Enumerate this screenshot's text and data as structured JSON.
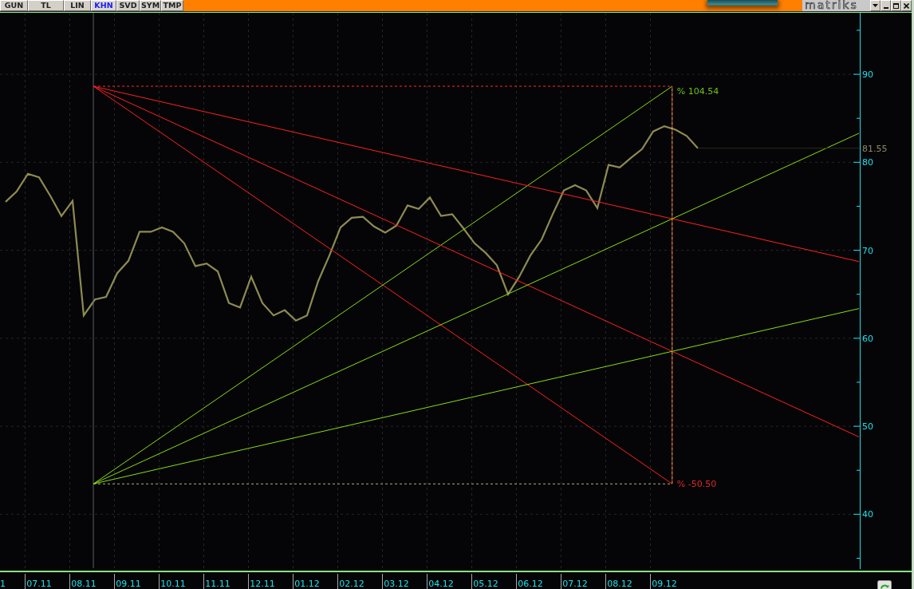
{
  "toolbar": {
    "mode_buttons": [
      {
        "label": "GUN",
        "selected": false
      },
      {
        "label": "TL",
        "selected": false
      },
      {
        "label": "LIN",
        "selected": false
      },
      {
        "label": "KHN",
        "selected": true
      },
      {
        "label": "SVD",
        "selected": false
      },
      {
        "label": "SYM",
        "selected": false
      },
      {
        "label": "TMP",
        "selected": false
      }
    ],
    "logo": "matriks"
  },
  "chart": {
    "x_axis_cut_label": "1",
    "last_price": "81.55",
    "gann_fan": {
      "upper_label": "% 104.54",
      "lower_label": "% -50.50"
    },
    "chart_data": {
      "type": "line",
      "categories": [
        null,
        null,
        null,
        "07.11",
        null,
        null,
        null,
        "08.11",
        null,
        null,
        null,
        "09.11",
        null,
        null,
        null,
        "10.11",
        null,
        null,
        null,
        "11.11",
        null,
        null,
        null,
        "12.11",
        null,
        null,
        null,
        "01.12",
        null,
        null,
        null,
        "02.12",
        null,
        null,
        null,
        "03.12",
        null,
        null,
        null,
        "04.12",
        null,
        null,
        null,
        "05.12",
        null,
        null,
        null,
        "06.12",
        null,
        null,
        null,
        "07.12",
        null,
        null,
        null,
        "08.12",
        null,
        null,
        null,
        "09.12",
        null,
        null,
        null,
        null,
        null,
        null,
        null,
        null,
        null,
        null,
        null,
        null,
        null,
        null,
        null,
        null,
        null
      ],
      "values": [
        75.5,
        76.7,
        78.7,
        78.3,
        76.2,
        73.9,
        75.6,
        62.6,
        64.4,
        64.7,
        67.4,
        68.8,
        72.1,
        72.1,
        72.6,
        72.1,
        70.8,
        68.2,
        68.5,
        67.6,
        64.0,
        63.5,
        67.0,
        64.0,
        62.6,
        63.2,
        62.0,
        62.6,
        66.5,
        69.4,
        72.6,
        73.7,
        73.8,
        72.7,
        72.0,
        72.8,
        75.1,
        74.7,
        76.0,
        73.9,
        74.1,
        72.5,
        70.8,
        69.7,
        68.3,
        65.0,
        67.0,
        69.4,
        71.2,
        74.1,
        76.8,
        77.4,
        76.8,
        74.8,
        79.7,
        79.4,
        80.5,
        81.5,
        83.5,
        84.1,
        83.7,
        83.0,
        81.6,
        null,
        null,
        null,
        null,
        null,
        null,
        null,
        null,
        null,
        null,
        null,
        null,
        null,
        null
      ],
      "ylim": [
        33.5,
        96.9
      ],
      "yticks": [
        40,
        50,
        60,
        70,
        80,
        90
      ],
      "grid": true
    }
  }
}
